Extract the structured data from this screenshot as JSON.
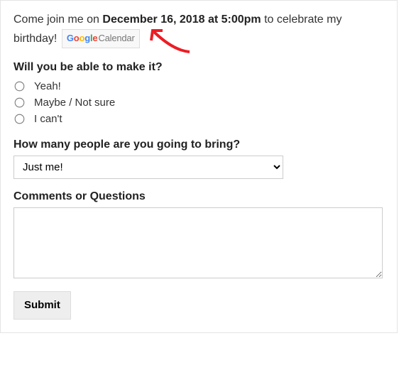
{
  "intro": {
    "pre": "Come join me on ",
    "datetime": "December 16, 2018 at 5:00pm",
    "mid": " to celebrate my birthday! ",
    "calendar_button": {
      "google": "Google",
      "calendar": "Calendar"
    }
  },
  "rsvp": {
    "question": "Will you be able to make it?",
    "options": [
      "Yeah!",
      "Maybe / Not sure",
      "I can't"
    ]
  },
  "guests": {
    "question": "How many people are you going to bring?",
    "selected": "Just me!"
  },
  "comments": {
    "label": "Comments or Questions",
    "value": ""
  },
  "submit_label": "Submit",
  "annotation_arrow": {
    "color": "#ed1c24"
  }
}
